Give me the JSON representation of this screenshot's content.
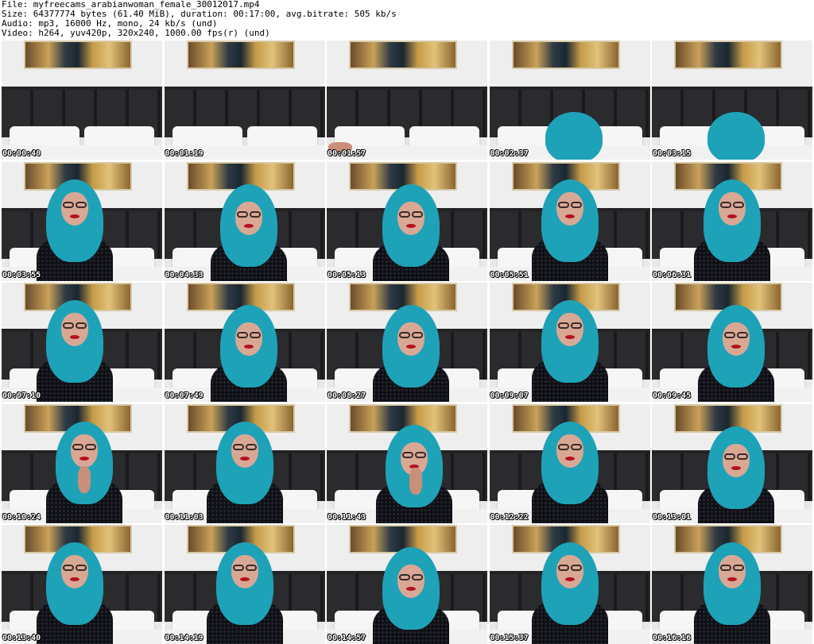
{
  "header": {
    "line1": "File: myfreecams_arabianwoman_female_30012017.mp4",
    "line2": "Size: 64377774 bytes (61.40 MiB), duration: 00:17:00, avg.bitrate: 505 kb/s",
    "line3": "Audio: mp3, 16000 Hz, mono, 24 kb/s (und)",
    "line4": "Video: h264, yuv420p, 320x240, 1000.00 fps(r) (und)"
  },
  "colors": {
    "scarf": "#1ea2b8",
    "lips": "#b3121f",
    "timestamp": "#ffffff"
  },
  "thumbnails": [
    {
      "timestamp": "00:00:40",
      "pose": "empty"
    },
    {
      "timestamp": "00:01:19",
      "pose": "empty"
    },
    {
      "timestamp": "00:01:57",
      "pose": "empty-hand"
    },
    {
      "timestamp": "00:02:37",
      "pose": "head-down"
    },
    {
      "timestamp": "00:03:15",
      "pose": "head-down"
    },
    {
      "timestamp": "00:03:55",
      "pose": "front-left"
    },
    {
      "timestamp": "00:04:33",
      "pose": "looking-down"
    },
    {
      "timestamp": "00:05:13",
      "pose": "looking-down"
    },
    {
      "timestamp": "00:05:51",
      "pose": "front"
    },
    {
      "timestamp": "00:06:31",
      "pose": "front"
    },
    {
      "timestamp": "00:07:10",
      "pose": "front-left"
    },
    {
      "timestamp": "00:07:49",
      "pose": "looking-down"
    },
    {
      "timestamp": "00:08:27",
      "pose": "looking-down"
    },
    {
      "timestamp": "00:09:07",
      "pose": "front"
    },
    {
      "timestamp": "00:09:45",
      "pose": "looking-down"
    },
    {
      "timestamp": "00:10:24",
      "pose": "hand-chin"
    },
    {
      "timestamp": "00:11:03",
      "pose": "front"
    },
    {
      "timestamp": "00:11:43",
      "pose": "hand-lip"
    },
    {
      "timestamp": "00:12:22",
      "pose": "front"
    },
    {
      "timestamp": "00:13:01",
      "pose": "looking-down"
    },
    {
      "timestamp": "00:13:40",
      "pose": "front-left"
    },
    {
      "timestamp": "00:14:19",
      "pose": "front"
    },
    {
      "timestamp": "00:14:57",
      "pose": "looking-down"
    },
    {
      "timestamp": "00:15:37",
      "pose": "front"
    },
    {
      "timestamp": "00:16:16",
      "pose": "front"
    }
  ]
}
